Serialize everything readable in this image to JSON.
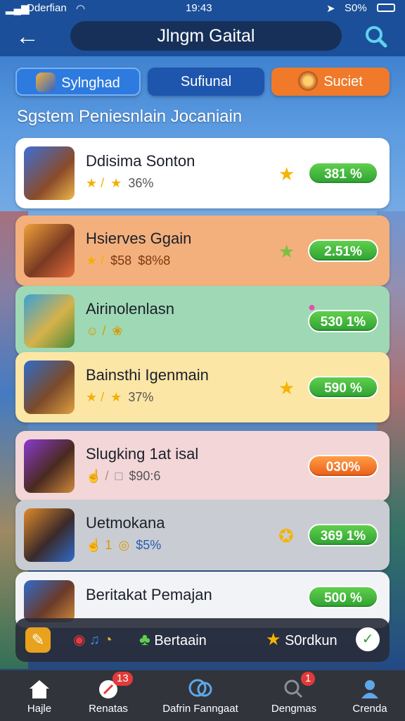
{
  "status_bar": {
    "carrier": "Dderfian",
    "time": "19:43",
    "battery": "S0%"
  },
  "header": {
    "title": "Jlngm Gaital"
  },
  "tabs": [
    {
      "label": "Sylnghad",
      "active": true
    },
    {
      "label": "Sufiunal",
      "active": false
    },
    {
      "label": "Suciet",
      "active": false
    }
  ],
  "section_title": "Sgstem Peniesnlain Jocaniain",
  "rows": [
    {
      "name": "Ddisima Sonton",
      "meta": [
        "★ /",
        "★",
        "36%"
      ],
      "icon": "star-icon",
      "score": "381 %",
      "score_color": "green"
    },
    {
      "name": "Hsierves Ggain",
      "meta": [
        "★ /",
        "$58",
        "$8%8"
      ],
      "icon": "star-icon",
      "score": "2.51%",
      "score_color": "green"
    },
    {
      "name": "Airinolenlasn",
      "meta": [
        "☺ /",
        "❀"
      ],
      "icon": "gem-icon",
      "score": "530 1%",
      "score_color": "green"
    },
    {
      "name": "Bainsthi Igenmain",
      "meta": [
        "★ /",
        "★",
        "37%"
      ],
      "icon": "star-icon",
      "score": "590 %",
      "score_color": "green"
    },
    {
      "name": "Slugking 1at isal",
      "meta": [
        "☝ /",
        "□",
        "$90:6"
      ],
      "icon": "",
      "score": "030%",
      "score_color": "orange"
    },
    {
      "name": "Uetmokana",
      "meta": [
        "☝ 1",
        "◎",
        "$5%"
      ],
      "icon": "star-icon",
      "score": "369 1%",
      "score_color": "green"
    },
    {
      "name": "Beritakat Pemajan",
      "meta": [],
      "icon": "",
      "score": "500 %",
      "score_color": "green"
    }
  ],
  "tray": {
    "label1": "Bertaain",
    "label2": "S0rdkun"
  },
  "nav": [
    {
      "label": "Hajle",
      "icon": "home-icon",
      "badge": ""
    },
    {
      "label": "Renatas",
      "icon": "compass-icon",
      "badge": "13"
    },
    {
      "label": "Dafrin Fanngaat",
      "icon": "chat-icon",
      "badge": ""
    },
    {
      "label": "Dengmas",
      "icon": "search-icon",
      "badge": "1"
    },
    {
      "label": "Crenda",
      "icon": "profile-icon",
      "badge": ""
    }
  ],
  "colors": {
    "header": "#1b4f99",
    "green_score": "#2fa233",
    "orange_score": "#ea5e19",
    "active_tab": "#2e7be0"
  }
}
